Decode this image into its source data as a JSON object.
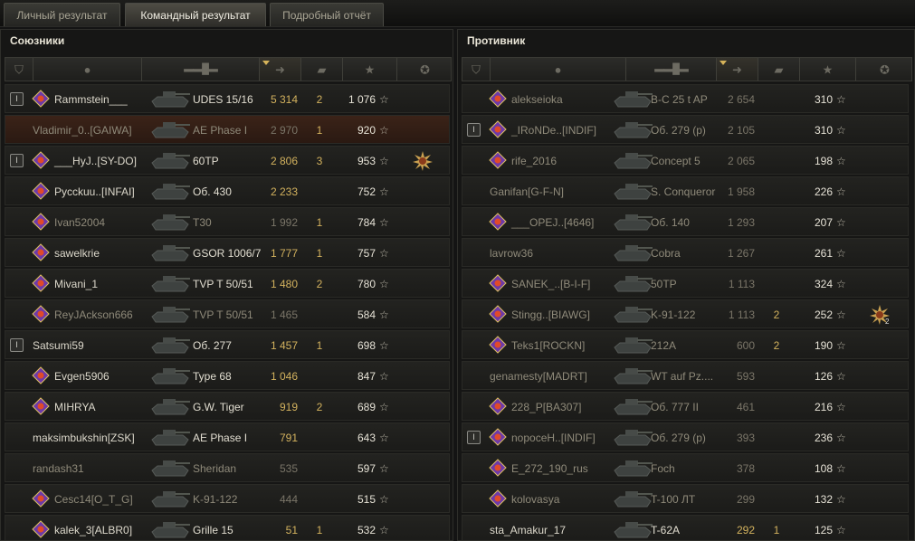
{
  "tabs": [
    {
      "label": "Личный результат",
      "active": false
    },
    {
      "label": "Командный результат",
      "active": true
    },
    {
      "label": "Подробный отчёт",
      "active": false
    }
  ],
  "allies": {
    "title": "Союзники",
    "rows": [
      {
        "platoon": true,
        "clan_icon": "clan-emblem-icon",
        "name": "Rammstein___",
        "tank": "UDES 15/16",
        "damage": "5 314",
        "kills": "2",
        "xp": "1 076",
        "medal": null,
        "self": false,
        "dead": false
      },
      {
        "platoon": false,
        "clan_icon": null,
        "name": "Vladimir_0..[GAIWA]",
        "tank": "AE Phase I",
        "damage": "2 970",
        "kills": "1",
        "xp": "920",
        "medal": null,
        "self": true,
        "dead": true
      },
      {
        "platoon": true,
        "clan_icon": "clan-emblem-icon",
        "name": "___HyJ..[SY-DO]",
        "tank": "60TP",
        "damage": "2 806",
        "kills": "3",
        "xp": "953",
        "medal": "achievement-medal-icon",
        "self": false,
        "dead": false
      },
      {
        "platoon": false,
        "clan_icon": "clan-emblem-icon",
        "name": "Pycckuu..[INFAI]",
        "tank": "Об. 430",
        "damage": "2 233",
        "kills": "",
        "xp": "752",
        "medal": null,
        "self": false,
        "dead": false
      },
      {
        "platoon": false,
        "clan_icon": "clan-emblem-icon",
        "name": "Ivan52004",
        "tank": "T30",
        "damage": "1 992",
        "kills": "1",
        "xp": "784",
        "medal": null,
        "self": false,
        "dead": true
      },
      {
        "platoon": false,
        "clan_icon": "clan-emblem-icon",
        "name": "sawelkrie",
        "tank": "GSOR 1006/7",
        "damage": "1 777",
        "kills": "1",
        "xp": "757",
        "medal": null,
        "self": false,
        "dead": false
      },
      {
        "platoon": false,
        "clan_icon": "clan-emblem-icon",
        "name": "Mivani_1",
        "tank": "TVP T 50/51",
        "damage": "1 480",
        "kills": "2",
        "xp": "780",
        "medal": null,
        "self": false,
        "dead": false
      },
      {
        "platoon": false,
        "clan_icon": "clan-emblem-icon",
        "name": "ReyJAckson666",
        "tank": "TVP T 50/51",
        "damage": "1 465",
        "kills": "",
        "xp": "584",
        "medal": null,
        "self": false,
        "dead": true
      },
      {
        "platoon": true,
        "clan_icon": null,
        "name": "Satsumi59",
        "tank": "Об. 277",
        "damage": "1 457",
        "kills": "1",
        "xp": "698",
        "medal": null,
        "self": false,
        "dead": false
      },
      {
        "platoon": false,
        "clan_icon": "clan-emblem-icon",
        "name": "Evgen5906",
        "tank": "Type 68",
        "damage": "1 046",
        "kills": "",
        "xp": "847",
        "medal": null,
        "self": false,
        "dead": false
      },
      {
        "platoon": false,
        "clan_icon": "clan-emblem-icon",
        "name": "MIHRYA",
        "tank": "G.W. Tiger",
        "damage": "919",
        "kills": "2",
        "xp": "689",
        "medal": null,
        "self": false,
        "dead": false
      },
      {
        "platoon": false,
        "clan_icon": null,
        "name": "maksimbukshin[ZSK]",
        "tank": "AE Phase I",
        "damage": "791",
        "kills": "",
        "xp": "643",
        "medal": null,
        "self": false,
        "dead": false
      },
      {
        "platoon": false,
        "clan_icon": null,
        "name": "randash31",
        "tank": "Sheridan",
        "damage": "535",
        "kills": "",
        "xp": "597",
        "medal": null,
        "self": false,
        "dead": true
      },
      {
        "platoon": false,
        "clan_icon": "clan-emblem-icon",
        "name": "Cesc14[O_T_G]",
        "tank": "K-91-122",
        "damage": "444",
        "kills": "",
        "xp": "515",
        "medal": null,
        "self": false,
        "dead": true
      },
      {
        "platoon": false,
        "clan_icon": "clan-emblem-icon",
        "name": "kalek_3[ALBR0]",
        "tank": "Grille 15",
        "damage": "51",
        "kills": "1",
        "xp": "532",
        "medal": null,
        "self": false,
        "dead": false
      }
    ]
  },
  "enemies": {
    "title": "Противник",
    "rows": [
      {
        "platoon": false,
        "clan_icon": "clan-emblem-icon",
        "name": "alekseioka",
        "tank": "B-C 25 t AP",
        "damage": "2 654",
        "kills": "",
        "xp": "310",
        "medal": null,
        "dead": true
      },
      {
        "platoon": true,
        "clan_icon": "clan-emblem-icon",
        "name": "_IRoNDe..[INDIF]",
        "tank": "Об. 279 (р)",
        "damage": "2 105",
        "kills": "",
        "xp": "310",
        "medal": null,
        "dead": true
      },
      {
        "platoon": false,
        "clan_icon": "clan-emblem-icon",
        "name": "rife_2016",
        "tank": "Concept 5",
        "damage": "2 065",
        "kills": "",
        "xp": "198",
        "medal": null,
        "dead": true
      },
      {
        "platoon": false,
        "clan_icon": null,
        "name": "Ganifan[G-F-N]",
        "tank": "S. Conqueror",
        "damage": "1 958",
        "kills": "",
        "xp": "226",
        "medal": null,
        "dead": true
      },
      {
        "platoon": false,
        "clan_icon": "clan-emblem-icon",
        "name": "___OPEJ..[4646]",
        "tank": "Об. 140",
        "damage": "1 293",
        "kills": "",
        "xp": "207",
        "medal": null,
        "dead": true
      },
      {
        "platoon": false,
        "clan_icon": null,
        "name": "lavrow36",
        "tank": "Cobra",
        "damage": "1 267",
        "kills": "",
        "xp": "261",
        "medal": null,
        "dead": true
      },
      {
        "platoon": false,
        "clan_icon": "clan-emblem-icon",
        "name": "SANEK_..[B-I-F]",
        "tank": "50TP",
        "damage": "1 113",
        "kills": "",
        "xp": "324",
        "medal": null,
        "dead": true
      },
      {
        "platoon": false,
        "clan_icon": "clan-emblem-icon",
        "name": "Stingg..[BIAWG]",
        "tank": "K-91-122",
        "damage": "1 113",
        "kills": "2",
        "xp": "252",
        "medal": "achievement-medal-icon",
        "medal_count": "2",
        "dead": true
      },
      {
        "platoon": false,
        "clan_icon": "clan-emblem-icon",
        "name": "Teks1[ROCKN]",
        "tank": "212A",
        "damage": "600",
        "kills": "2",
        "xp": "190",
        "medal": null,
        "dead": true
      },
      {
        "platoon": false,
        "clan_icon": null,
        "name": "genamesty[MADRT]",
        "tank": "WT auf Pz....",
        "damage": "593",
        "kills": "",
        "xp": "126",
        "medal": null,
        "dead": true
      },
      {
        "platoon": false,
        "clan_icon": "clan-emblem-icon",
        "name": "228_P[BA307]",
        "tank": "Об. 777 II",
        "damage": "461",
        "kills": "",
        "xp": "216",
        "medal": null,
        "dead": true
      },
      {
        "platoon": true,
        "clan_icon": "clan-emblem-icon",
        "name": "nopoceH..[INDIF]",
        "tank": "Об. 279 (р)",
        "damage": "393",
        "kills": "",
        "xp": "236",
        "medal": null,
        "dead": true
      },
      {
        "platoon": false,
        "clan_icon": "clan-emblem-icon",
        "name": "E_272_190_rus",
        "tank": "Foch",
        "damage": "378",
        "kills": "",
        "xp": "108",
        "medal": null,
        "dead": true
      },
      {
        "platoon": false,
        "clan_icon": "clan-emblem-icon",
        "name": "kolovasya",
        "tank": "T-100 ЛТ",
        "damage": "299",
        "kills": "",
        "xp": "132",
        "medal": null,
        "dead": true
      },
      {
        "platoon": false,
        "clan_icon": null,
        "name": "sta_Amakur_17",
        "tank": "T-62A",
        "damage": "292",
        "kills": "1",
        "xp": "125",
        "medal": null,
        "dead": false
      }
    ]
  },
  "icons": {
    "star": "☆",
    "platoon": "I"
  },
  "colors": {
    "damage": "#d3b25e",
    "self_row": "#3b2318"
  }
}
